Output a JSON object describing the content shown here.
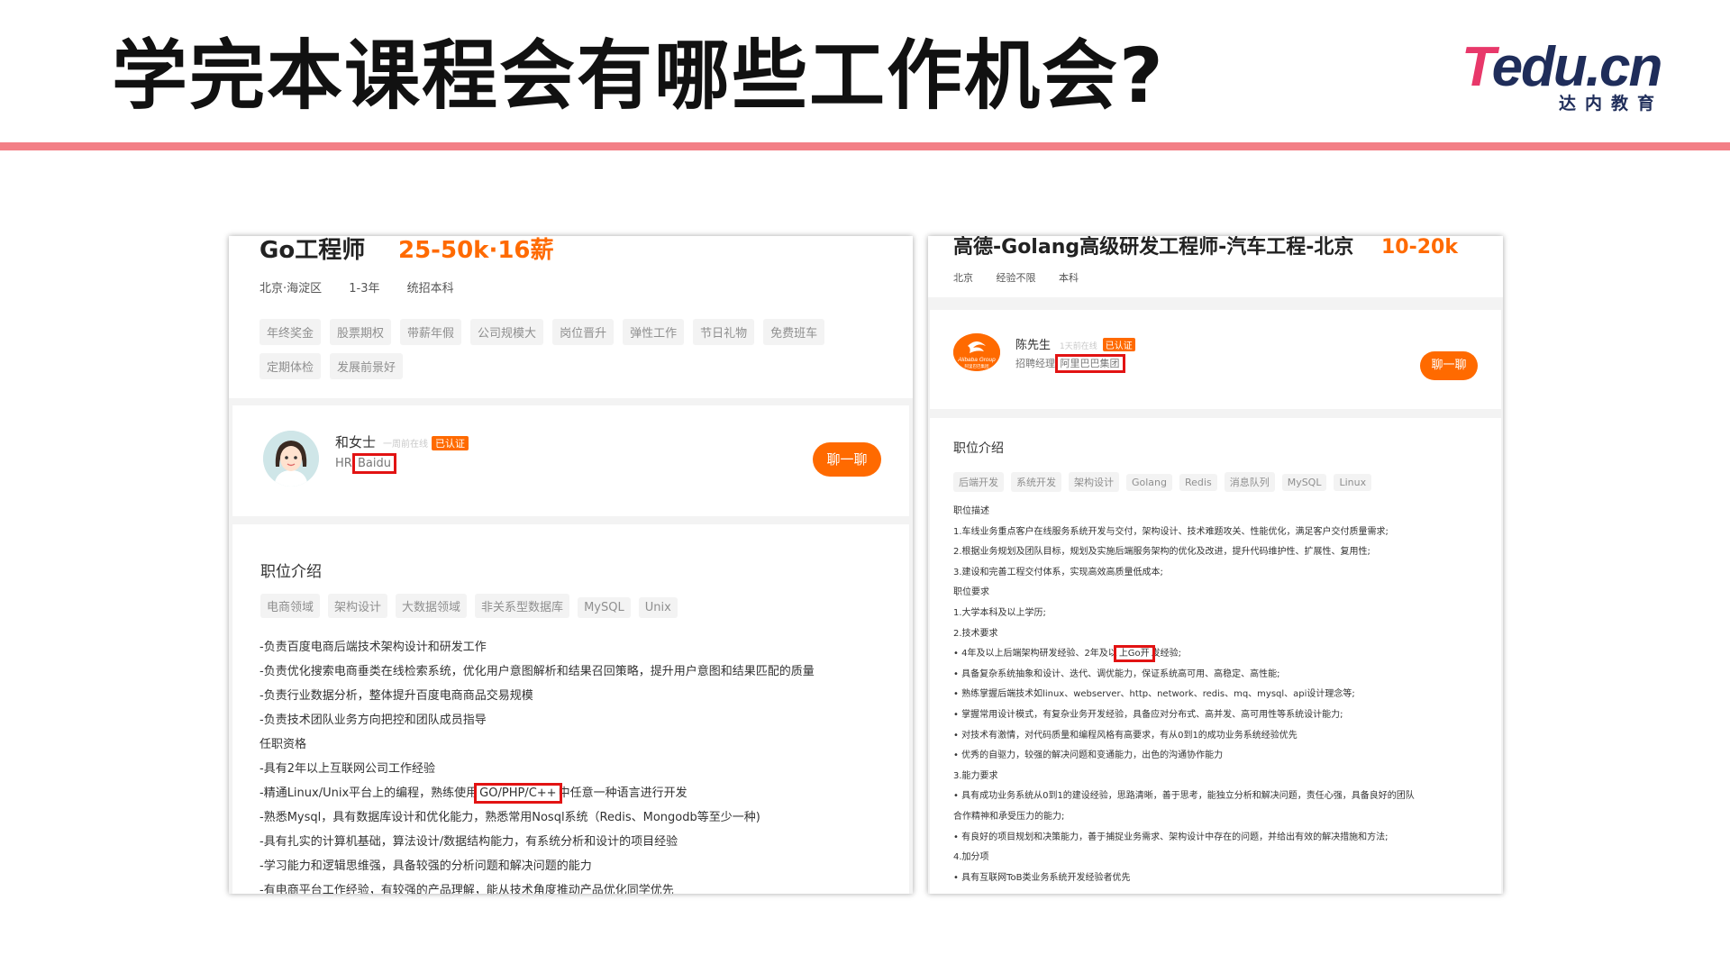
{
  "slide": {
    "title": "学完本课程会有哪些工作机会?",
    "logo_main_t": "T",
    "logo_main_rest": "edu.cn",
    "logo_sub": "达内教育"
  },
  "colors": {
    "accent": "#f37f86",
    "brand_orange": "#ff6a00",
    "highlight_red": "#e21313"
  },
  "left_card": {
    "job_title": "Go工程师",
    "salary": "25-50k·16薪",
    "meta": [
      "北京·海淀区",
      "1-3年",
      "统招本科"
    ],
    "benefits": [
      "年终奖金",
      "股票期权",
      "带薪年假",
      "公司规模大",
      "岗位晋升",
      "弹性工作",
      "节日礼物",
      "免费班车",
      "定期体检",
      "发展前景好"
    ],
    "recruiter": {
      "name": "和女士",
      "online": "一周前在线",
      "certified": "已认证",
      "role": "HR",
      "company": "Baidu",
      "chat": "聊一聊"
    },
    "section_title": "职位介绍",
    "skills": [
      "电商领域",
      "架构设计",
      "大数据领域",
      "非关系型数据库",
      "MySQL",
      "Unix"
    ],
    "desc": {
      "l1": "-负责百度电商后端技术架构设计和研发工作",
      "l2": "-负责优化搜索电商垂类在线检索系统，优化用户意图解析和结果召回策略，提升用户意图和结果匹配的质量",
      "l3": "-负责行业数据分析，整体提升百度电商商品交易规模",
      "l4": "-负责技术团队业务方向把控和团队成员指导",
      "l5": "任职资格",
      "l6": "-具有2年以上互联网公司工作经验",
      "l7_pre": "-精通Linux/Unix平台上的编程，熟练使用",
      "l7_hl": "GO/PHP/C++",
      "l7_post": "中任意一种语言进行开发",
      "l8": "-熟悉Mysql，具有数据库设计和优化能力，熟悉常用Nosql系统（Redis、Mongodb等至少一种)",
      "l9": "-具有扎实的计算机基础，算法设计/数据结构能力，有系统分析和设计的项目经验",
      "l10": "-学习能力和逻辑思维强，具备较强的分析问题和解决问题的能力",
      "l11": "-有电商平台工作经验，有较强的产品理解，能从技术角度推动产品优化同学优先"
    }
  },
  "right_card": {
    "job_title": "高德-Golang高级研发工程师-汽车工程-北京",
    "salary": "10-20k",
    "meta": [
      "北京",
      "经验不限",
      "本科"
    ],
    "recruiter": {
      "name": "陈先生",
      "online": "1天前在线",
      "certified": "已认证",
      "role": "招聘经理",
      "company": "阿里巴巴集团",
      "chat": "聊一聊",
      "logo_text": "Alibaba Group",
      "logo_text_cn": "阿里巴巴集团"
    },
    "section_title": "职位介绍",
    "skills": [
      "后端开发",
      "系统开发",
      "架构设计",
      "Golang",
      "Redis",
      "消息队列",
      "MySQL",
      "Linux"
    ],
    "desc": {
      "l1": "职位描述",
      "l2": "1.车线业务重点客户在线服务系统开发与交付，架构设计、技术难题攻关、性能优化，满足客户交付质量需求;",
      "l3": "2.根据业务规划及团队目标，规划及实施后端服务架构的优化及改进，提升代码维护性、扩展性、复用性;",
      "l4": "3.建设和完善工程交付体系，实现高效高质量低成本;",
      "l5": "职位要求",
      "l6": "1.大学本科及以上学历;",
      "l7": "2.技术要求",
      "l8_pre": "• 4年及以上后端架构研发经验、2年及以",
      "l8_hl": "上Go开",
      "l8_post": "发经验;",
      "l9": "• 具备复杂系统抽象和设计、迭代、调优能力，保证系统高可用、高稳定、高性能;",
      "l10": "• 熟练掌握后端技术如linux、webserver、http、network、redis、mq、mysql、api设计理念等;",
      "l11": "• 掌握常用设计模式，有复杂业务开发经验，具备应对分布式、高并发、高可用性等系统设计能力;",
      "l12": "• 对技术有激情，对代码质量和编程风格有高要求，有从0到1的成功业务系统经验优先",
      "l13": "• 优秀的自驱力，较强的解决问题和变通能力，出色的沟通协作能力",
      "l14": "3.能力要求",
      "l15": "• 具有成功业务系统从0到1的建设经验，思路清晰，善于思考，能独立分析和解决问题，责任心强，具备良好的团队",
      "l16": "合作精神和承受压力的能力;",
      "l17": "• 有良好的项目规划和决策能力，善于捕捉业务需求、架构设计中存在的问题，并给出有效的解决措施和方法;",
      "l18": "4.加分项",
      "l19": "• 具有互联网ToB类业务系统开发经验者优先"
    }
  }
}
